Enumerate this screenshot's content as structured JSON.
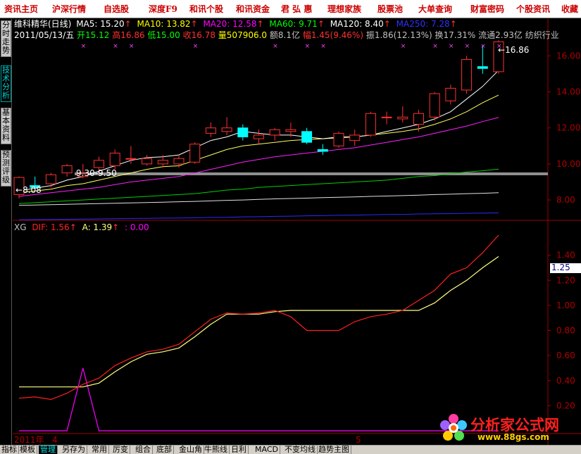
{
  "menu": {
    "items": [
      "资讯主页",
      "沪深行情",
      "自选股",
      "深度F9",
      "和讯个股",
      "和讯资金",
      "君 弘 惠",
      "理想家族",
      "股票池",
      "大单查询",
      "财富密码",
      "个股资讯",
      "收藏"
    ]
  },
  "side_tabs": [
    "分时走势",
    "技术分析",
    "基本资料",
    "预测评级"
  ],
  "main_panel": {
    "title": "维科精华(日线)",
    "ma": [
      {
        "label": "MA5: 15.20",
        "color": "#ffffff"
      },
      {
        "label": "MA10: 13.82",
        "color": "#ffff00"
      },
      {
        "label": "MA20: 12.58",
        "color": "#ff00ff"
      },
      {
        "label": "MA60: 9.71",
        "color": "#00ff00"
      },
      {
        "label": "MA120: 8.40",
        "color": "#ffffff"
      },
      {
        "label": "MA250: 7.28",
        "color": "#3030ff"
      }
    ],
    "info": {
      "date": "2011/05/13/五",
      "open": "开15.12",
      "high": "高16.86",
      "low": "低15.00",
      "close": "收16.78",
      "vol": "量507906.0",
      "amount": "额8.1亿",
      "change": "幅1.45(9.46%)",
      "amp": "振1.86(12.13%)",
      "turnover": "换17.31%",
      "float_cap": "流通2.93亿",
      "industry": "纺织行业"
    },
    "price_high_label": "16.86",
    "price_low_label": "8.08",
    "range_label": "9.30-9.50",
    "y_ticks": [
      "16.00",
      "14.00",
      "12.00",
      "10.00",
      "8.00"
    ]
  },
  "sub_panel": {
    "name": "XG",
    "dif_label": "DIF: 1.56",
    "a_label": "A: 1.39",
    "third_label": ": 0.00",
    "y_ticks": [
      "1.40",
      "1.20",
      "1.00",
      "0.80",
      "0.60",
      "0.40",
      "0.20"
    ],
    "current_value": "1.25"
  },
  "x_axis": {
    "year_label": "2011年",
    "month_label_1": "4",
    "month_label_2": "5"
  },
  "bottom_tabs": [
    "指标",
    "模板",
    "管理",
    "另存为",
    "常用",
    "厉变",
    "组合",
    "底部",
    "金山角",
    "牛熊线",
    "日利",
    "MACD",
    "不变均线",
    "趋势主图"
  ],
  "watermark": {
    "title": "分析家公式网",
    "url": "www.88gs.com"
  },
  "colors": {
    "up": "#ff3030",
    "down": "#00ffff",
    "dif": "#ff2020",
    "a_line": "#ffff80",
    "third_line": "#ff00ff",
    "menu_text": "#cc0000"
  },
  "chart_data": {
    "type": "candlestick",
    "candles": [
      {
        "o": 8.3,
        "h": 9.3,
        "l": 8.08,
        "c": 9.25
      },
      {
        "o": 8.8,
        "h": 9.3,
        "l": 8.6,
        "c": 8.7
      },
      {
        "o": 8.9,
        "h": 9.5,
        "l": 8.7,
        "c": 9.4
      },
      {
        "o": 9.5,
        "h": 10.0,
        "l": 9.3,
        "c": 9.9
      },
      {
        "o": 9.3,
        "h": 10.0,
        "l": 9.2,
        "c": 9.45
      },
      {
        "o": 9.8,
        "h": 10.4,
        "l": 9.6,
        "c": 10.2
      },
      {
        "o": 9.9,
        "h": 10.8,
        "l": 9.7,
        "c": 10.6
      },
      {
        "o": 10.3,
        "h": 11.0,
        "l": 10.0,
        "c": 10.3
      },
      {
        "o": 10.0,
        "h": 10.5,
        "l": 9.9,
        "c": 10.3
      },
      {
        "o": 10.0,
        "h": 10.5,
        "l": 9.8,
        "c": 10.2
      },
      {
        "o": 10.0,
        "h": 10.5,
        "l": 9.8,
        "c": 10.3
      },
      {
        "o": 10.1,
        "h": 11.2,
        "l": 10.0,
        "c": 11.1
      },
      {
        "o": 11.7,
        "h": 12.3,
        "l": 11.5,
        "c": 12.0
      },
      {
        "o": 11.8,
        "h": 12.6,
        "l": 11.6,
        "c": 12.0
      },
      {
        "o": 12.0,
        "h": 12.2,
        "l": 11.3,
        "c": 11.5
      },
      {
        "o": 11.4,
        "h": 11.9,
        "l": 11.1,
        "c": 11.6
      },
      {
        "o": 11.6,
        "h": 12.0,
        "l": 11.3,
        "c": 11.9
      },
      {
        "o": 11.8,
        "h": 12.3,
        "l": 11.5,
        "c": 11.9
      },
      {
        "o": 11.8,
        "h": 12.0,
        "l": 11.1,
        "c": 11.2
      },
      {
        "o": 10.8,
        "h": 11.1,
        "l": 10.5,
        "c": 10.7
      },
      {
        "o": 11.0,
        "h": 11.8,
        "l": 10.9,
        "c": 11.7
      },
      {
        "o": 11.3,
        "h": 11.9,
        "l": 11.0,
        "c": 11.6
      },
      {
        "o": 11.6,
        "h": 12.9,
        "l": 11.5,
        "c": 12.8
      },
      {
        "o": 12.6,
        "h": 12.9,
        "l": 12.2,
        "c": 12.6
      },
      {
        "o": 12.5,
        "h": 13.2,
        "l": 12.3,
        "c": 12.6
      },
      {
        "o": 12.2,
        "h": 13.0,
        "l": 11.8,
        "c": 12.8
      },
      {
        "o": 12.6,
        "h": 14.0,
        "l": 12.4,
        "c": 13.9
      },
      {
        "o": 13.5,
        "h": 14.4,
        "l": 13.3,
        "c": 14.2
      },
      {
        "o": 14.1,
        "h": 16.0,
        "l": 13.9,
        "c": 15.8
      },
      {
        "o": 15.4,
        "h": 16.6,
        "l": 15.0,
        "c": 15.3
      },
      {
        "o": 15.12,
        "h": 16.86,
        "l": 15.0,
        "c": 16.78
      }
    ],
    "price_range": [
      7.3,
      16.95
    ],
    "ma5": [
      8.5,
      8.65,
      8.8,
      9.1,
      9.3,
      9.6,
      9.9,
      10.2,
      10.35,
      10.4,
      10.5,
      10.9,
      11.3,
      11.5,
      11.8,
      11.7,
      11.6,
      11.6,
      11.5,
      11.4,
      11.5,
      11.5,
      11.6,
      11.8,
      12.0,
      12.2,
      12.5,
      12.9,
      13.6,
      14.3,
      15.2
    ],
    "ma10": [
      8.4,
      8.5,
      8.6,
      8.8,
      8.9,
      9.1,
      9.3,
      9.5,
      9.7,
      9.85,
      9.9,
      10.2,
      10.5,
      10.8,
      11.0,
      11.1,
      11.2,
      11.3,
      11.35,
      11.4,
      11.45,
      11.5,
      11.6,
      11.7,
      11.8,
      11.95,
      12.2,
      12.5,
      12.9,
      13.4,
      13.82
    ],
    "ma20": [
      8.2,
      8.3,
      8.4,
      8.5,
      8.6,
      8.7,
      8.85,
      9.0,
      9.1,
      9.2,
      9.3,
      9.5,
      9.7,
      9.9,
      10.1,
      10.25,
      10.4,
      10.5,
      10.6,
      10.7,
      10.8,
      10.9,
      11.05,
      11.2,
      11.35,
      11.5,
      11.7,
      11.9,
      12.1,
      12.35,
      12.58
    ],
    "ma60": [
      7.8,
      7.85,
      7.9,
      7.95,
      8.0,
      8.05,
      8.1,
      8.15,
      8.2,
      8.25,
      8.3,
      8.35,
      8.45,
      8.55,
      8.6,
      8.7,
      8.75,
      8.8,
      8.85,
      8.9,
      8.95,
      9.0,
      9.05,
      9.1,
      9.2,
      9.3,
      9.35,
      9.45,
      9.55,
      9.62,
      9.71
    ],
    "ma120": [
      7.7,
      7.72,
      7.74,
      7.76,
      7.78,
      7.8,
      7.82,
      7.84,
      7.86,
      7.88,
      7.9,
      7.92,
      7.95,
      7.98,
      8.0,
      8.03,
      8.06,
      8.08,
      8.1,
      8.13,
      8.15,
      8.17,
      8.2,
      8.22,
      8.24,
      8.27,
      8.3,
      8.32,
      8.35,
      8.37,
      8.4
    ],
    "ma250": [
      6.9,
      6.91,
      6.92,
      6.93,
      6.94,
      6.95,
      6.96,
      6.97,
      6.98,
      6.99,
      7.0,
      7.01,
      7.03,
      7.04,
      7.06,
      7.07,
      7.09,
      7.1,
      7.12,
      7.13,
      7.15,
      7.16,
      7.18,
      7.19,
      7.2,
      7.22,
      7.23,
      7.24,
      7.26,
      7.27,
      7.28
    ],
    "dif": [
      0.26,
      0.27,
      0.25,
      0.3,
      0.37,
      0.42,
      0.52,
      0.58,
      0.63,
      0.65,
      0.69,
      0.79,
      0.89,
      0.94,
      0.93,
      0.94,
      0.96,
      0.91,
      0.8,
      0.8,
      0.8,
      0.87,
      0.91,
      0.93,
      0.96,
      1.04,
      1.12,
      1.25,
      1.3,
      1.42,
      1.56
    ],
    "a_line": [
      0.35,
      0.35,
      0.35,
      0.35,
      0.35,
      0.38,
      0.47,
      0.55,
      0.61,
      0.63,
      0.66,
      0.75,
      0.85,
      0.93,
      0.93,
      0.93,
      0.95,
      0.96,
      0.96,
      0.96,
      0.96,
      0.96,
      0.96,
      0.96,
      0.96,
      0.96,
      1.02,
      1.12,
      1.2,
      1.3,
      1.39
    ],
    "third": [
      0.0,
      0.0,
      0.0,
      0.0,
      0.5,
      0.0,
      0.0,
      0.0,
      0.0,
      0.0,
      0.0,
      0.0,
      0.0,
      0.0,
      0.0,
      0.0,
      0.0,
      0.0,
      0.0,
      0.0,
      0.0,
      0.0,
      0.0,
      0.0,
      0.0,
      0.0,
      0.0,
      0.0,
      0.0,
      0.0,
      0.0
    ],
    "sub_range": [
      0.0,
      1.6
    ]
  }
}
